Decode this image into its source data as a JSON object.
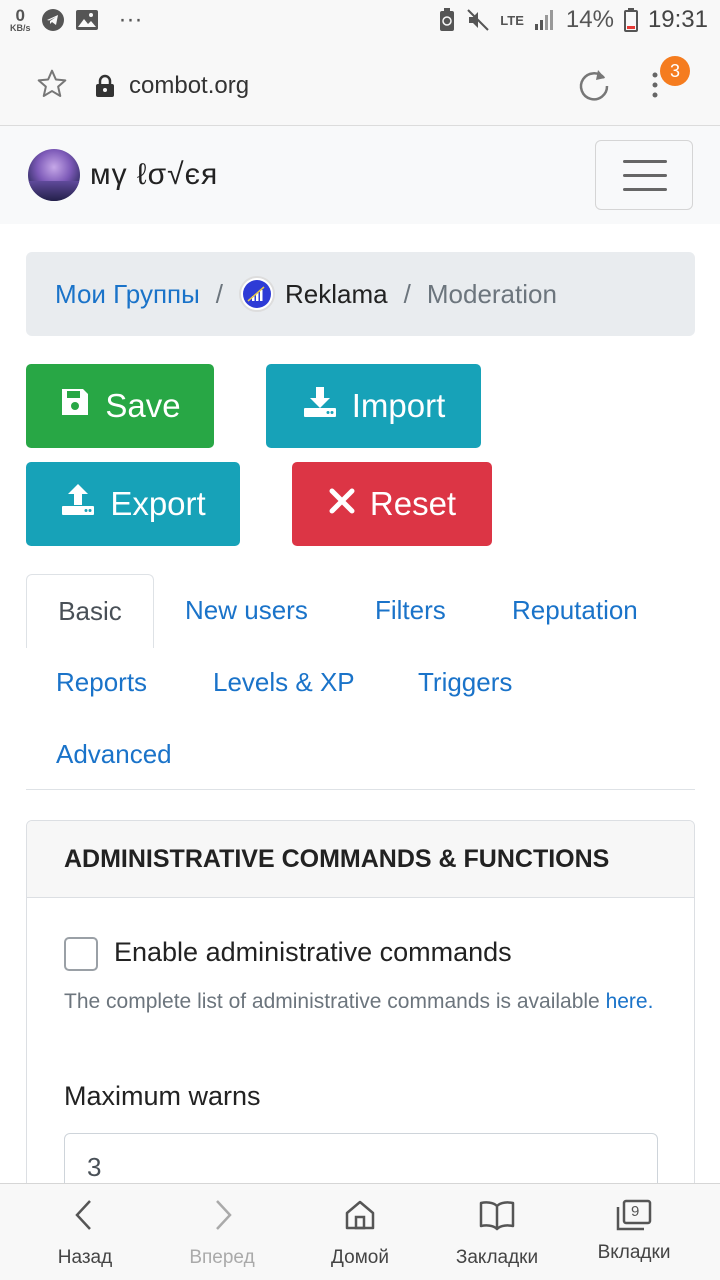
{
  "status_bar": {
    "net_speed": "0",
    "net_unit": "KB/s",
    "more": "···",
    "network": "LTE",
    "battery": "14%",
    "time": "19:31"
  },
  "browser": {
    "url": "combot.org",
    "tab_badge": "3"
  },
  "site": {
    "brand": "мγ ℓσ√єя"
  },
  "breadcrumb": {
    "groups": "Мои Группы",
    "group": "Reklama",
    "current": "Moderation",
    "separator": "/"
  },
  "actions": {
    "save": "Save",
    "import": "Import",
    "export": "Export",
    "reset": "Reset"
  },
  "tabs": [
    "Basic",
    "New users",
    "Filters",
    "Reputation",
    "Reports",
    "Levels & XP",
    "Triggers",
    "Advanced"
  ],
  "card": {
    "title": "ADMINISTRATIVE COMMANDS & FUNCTIONS",
    "checkbox_label": "Enable administrative commands",
    "help_text": "The complete list of administrative commands is available",
    "help_link": "here.",
    "max_warns_label": "Maximum warns",
    "max_warns_value": "3"
  },
  "bottom_nav": {
    "back": "Назад",
    "forward": "Вперед",
    "home": "Домой",
    "bookmarks": "Закладки",
    "tabs": "Вкладки",
    "tab_count": "9"
  },
  "colors": {
    "primary_link": "#1a73c9",
    "save": "#28a745",
    "info": "#17a2b8",
    "danger": "#dc3545",
    "badge": "#f57c1f"
  }
}
